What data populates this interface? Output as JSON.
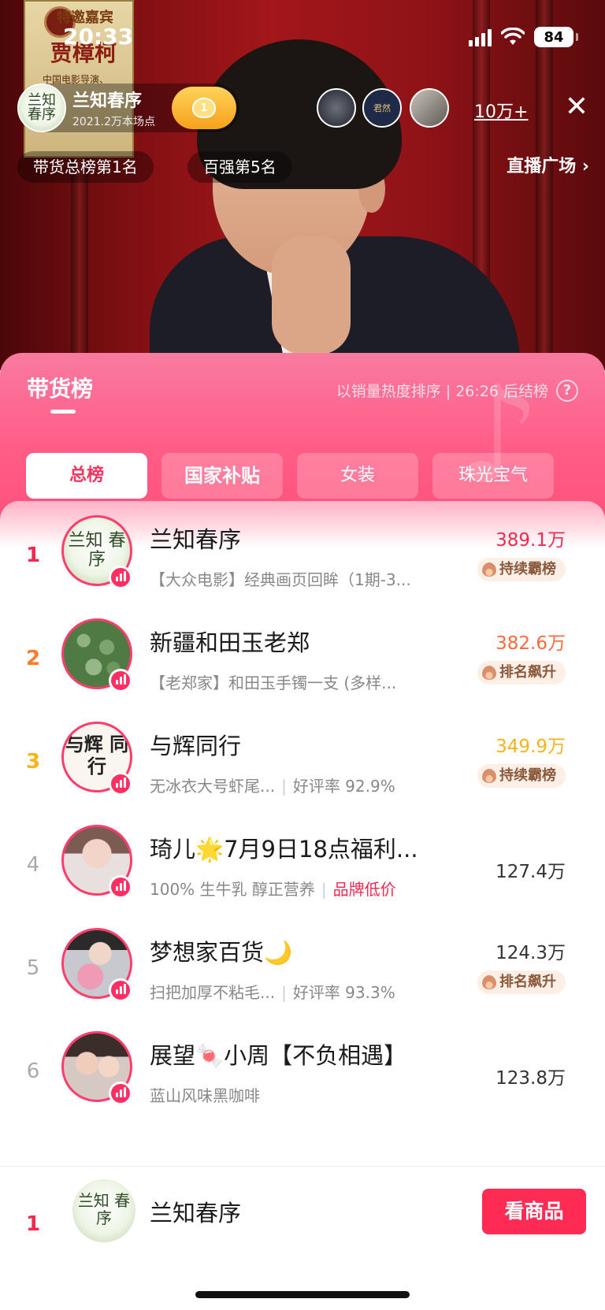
{
  "status_bar": {
    "time": "20:33",
    "battery": "84"
  },
  "live": {
    "host_name": "兰知春序",
    "host_sub": "2021.2万本场点",
    "host_avatar_text": "兰知 春序",
    "fans_level": "1",
    "viewer_count": "10万+",
    "rank_tags": [
      "带货总榜第1名",
      "百强第5名"
    ],
    "square_label": "直播广场 ›",
    "background": {
      "poster_title": "特邀嘉宾",
      "poster_name": "贾樟柯",
      "poster_desc": "中国电影导演、"
    },
    "viewer_badge_text": "君然"
  },
  "panel": {
    "title": "带货榜",
    "hint": "以销量热度排序 | 26:26 后结榜",
    "help": "?",
    "logo": "♪",
    "tabs": [
      "总榜",
      "国家补贴",
      "女装",
      "珠光宝气"
    ]
  },
  "ranking": [
    {
      "rank": "1",
      "name": "兰知春序",
      "avatar_text": "兰知 春序",
      "desc": "【大众电影】经典画页回眸（1期-3...",
      "value": "389.1万",
      "badge": "持续霸榜"
    },
    {
      "rank": "2",
      "name": "新疆和田玉老郑",
      "desc": "【老郑家】和田玉手镯一支 (多样...",
      "value": "382.6万",
      "badge": "排名飙升"
    },
    {
      "rank": "3",
      "name": "与辉同行",
      "avatar_text": "与辉 同行",
      "desc": "无冰衣大号虾尾...",
      "desc_extra": "好评率 92.9%",
      "value": "349.9万",
      "badge": "持续霸榜"
    },
    {
      "rank": "4",
      "name": "琦儿🌟7月9日18点福利...",
      "desc": "100% 生牛乳 醇正营养",
      "desc_tag": "品牌低价",
      "value": "127.4万"
    },
    {
      "rank": "5",
      "name": "梦想家百货🌙",
      "desc": "扫把加厚不粘毛...",
      "desc_extra": "好评率 93.3%",
      "value": "124.3万",
      "badge": "排名飙升"
    },
    {
      "rank": "6",
      "name": "展望🍬小周【不负相遇】",
      "desc": "蓝山风味黑咖啡",
      "value": "123.8万"
    }
  ],
  "bottom": {
    "rank": "1",
    "name": "兰知春序",
    "avatar_text": "兰知 春序",
    "button": "看商品"
  },
  "colors": {
    "accent": "#fe2c55",
    "panel_gradient": "#ff5d87",
    "rank1": "#f2284f",
    "rank2": "#ff7b2c",
    "rank3": "#f8b21a"
  }
}
